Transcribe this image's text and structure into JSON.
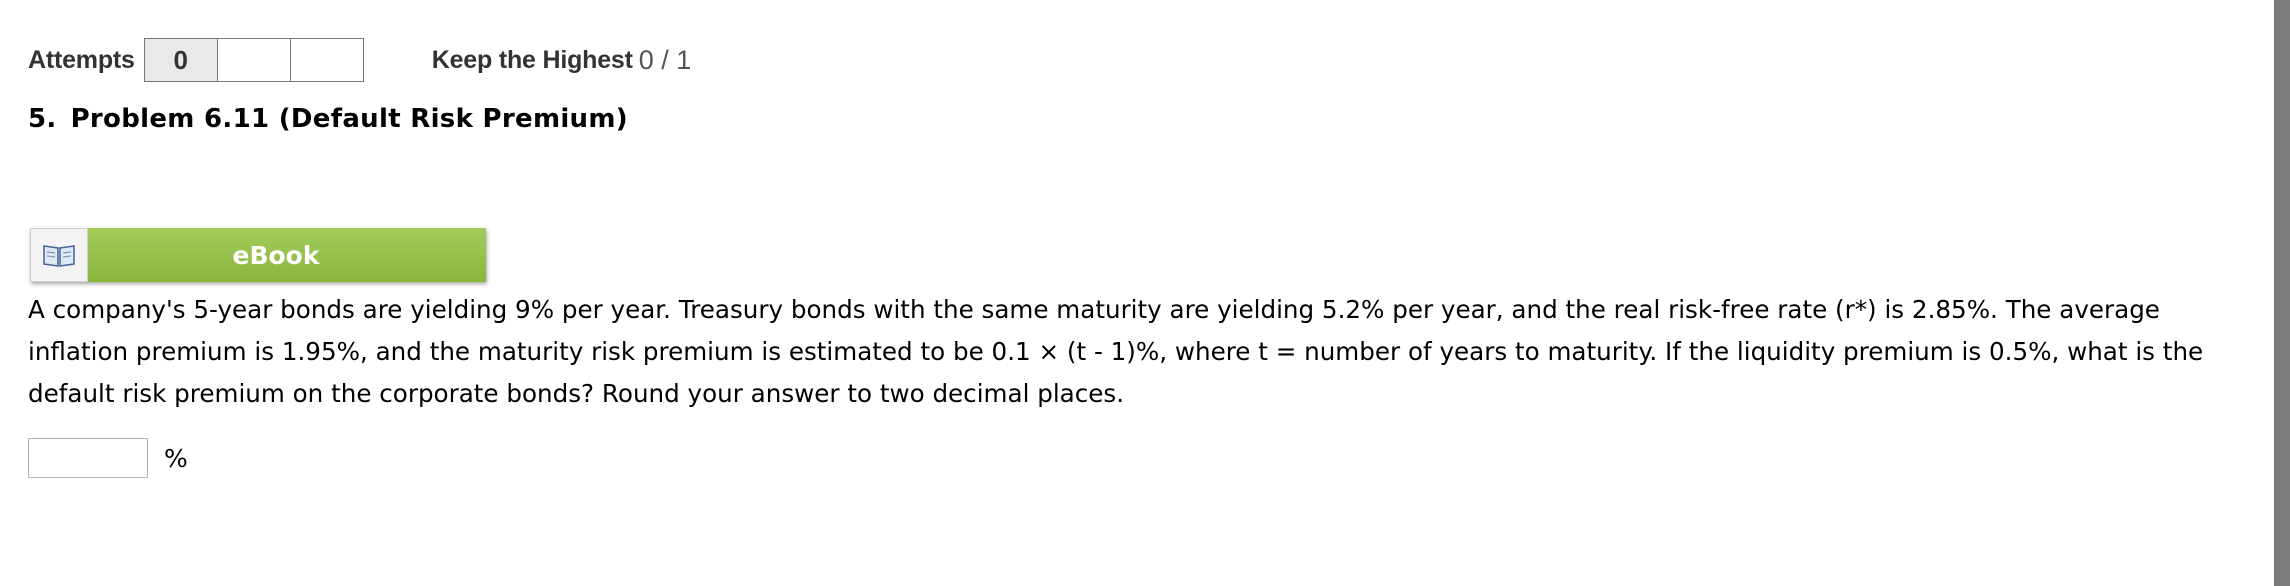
{
  "attempts": {
    "label": "Attempts",
    "boxes": [
      "0",
      "",
      ""
    ]
  },
  "scoring": {
    "label": "Keep the Highest",
    "score": "0 / 1"
  },
  "problem": {
    "number": "5.",
    "title": "Problem 6.11 (Default Risk Premium)",
    "text": "A company's 5-year bonds are yielding 9% per year. Treasury bonds with the same maturity are yielding 5.2% per year, and the real risk-free rate (r*) is 2.85%. The average inflation premium is 1.95%, and the maturity risk premium is estimated to be 0.1 × (t - 1)%, where t = number of years to maturity. If the liquidity premium is 0.5%, what is the default risk premium on the corporate bonds? Round your answer to two decimal places."
  },
  "ebook": {
    "label": "eBook",
    "icon": "open-book-icon"
  },
  "answer": {
    "value": "",
    "unit": "%"
  },
  "colors": {
    "ebook_green": "#98c14b",
    "scroll_gray": "#7b7b7b"
  }
}
